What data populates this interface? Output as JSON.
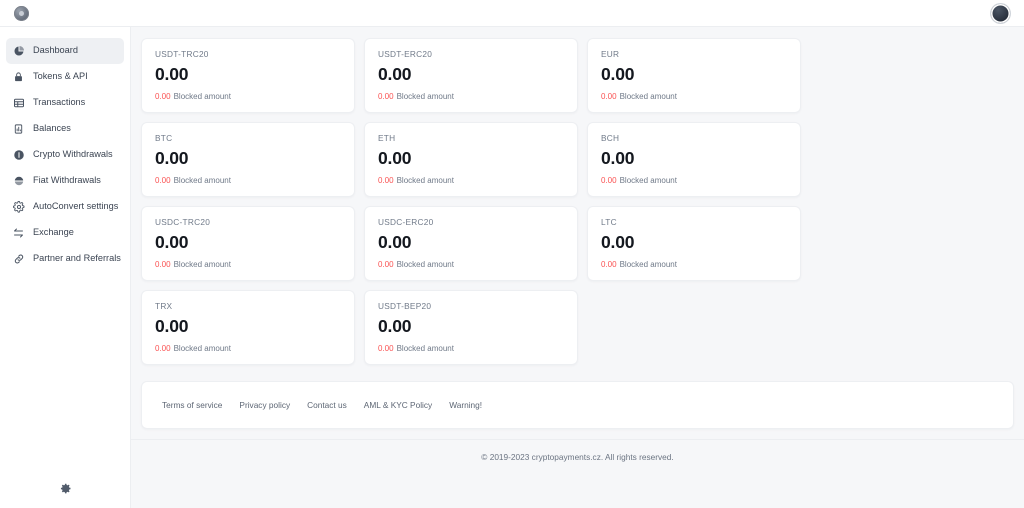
{
  "topbar": {
    "logo_icon": "circular-brand-logo",
    "avatar_icon": "user-avatar"
  },
  "sidebar": {
    "items": [
      {
        "label": "Dashboard",
        "icon": "pie-chart-icon",
        "active": true
      },
      {
        "label": "Tokens & API",
        "icon": "lock-icon",
        "active": false
      },
      {
        "label": "Transactions",
        "icon": "table-icon",
        "active": false
      },
      {
        "label": "Balances",
        "icon": "bar-chart-icon",
        "active": false
      },
      {
        "label": "Crypto Withdrawals",
        "icon": "coin-icon",
        "active": false
      },
      {
        "label": "Fiat Withdrawals",
        "icon": "banknote-icon",
        "active": false
      },
      {
        "label": "AutoConvert settings",
        "icon": "gear-icon",
        "active": false
      },
      {
        "label": "Exchange",
        "icon": "swap-arrows-icon",
        "active": false
      },
      {
        "label": "Partner and Referrals",
        "icon": "link-chain-icon",
        "active": false
      }
    ],
    "settings_icon": "gear-icon"
  },
  "main": {
    "balance_cards": [
      {
        "currency": "USDT-TRC20",
        "amount": "0.00",
        "blocked_amount": "0.00",
        "blocked_label": "Blocked amount"
      },
      {
        "currency": "USDT-ERC20",
        "amount": "0.00",
        "blocked_amount": "0.00",
        "blocked_label": "Blocked amount"
      },
      {
        "currency": "EUR",
        "amount": "0.00",
        "blocked_amount": "0.00",
        "blocked_label": "Blocked amount"
      },
      {
        "currency": "BTC",
        "amount": "0.00",
        "blocked_amount": "0.00",
        "blocked_label": "Blocked amount"
      },
      {
        "currency": "ETH",
        "amount": "0.00",
        "blocked_amount": "0.00",
        "blocked_label": "Blocked amount"
      },
      {
        "currency": "BCH",
        "amount": "0.00",
        "blocked_amount": "0.00",
        "blocked_label": "Blocked amount"
      },
      {
        "currency": "USDC-TRC20",
        "amount": "0.00",
        "blocked_amount": "0.00",
        "blocked_label": "Blocked amount"
      },
      {
        "currency": "USDC-ERC20",
        "amount": "0.00",
        "blocked_amount": "0.00",
        "blocked_label": "Blocked amount"
      },
      {
        "currency": "LTC",
        "amount": "0.00",
        "blocked_amount": "0.00",
        "blocked_label": "Blocked amount"
      },
      {
        "currency": "TRX",
        "amount": "0.00",
        "blocked_amount": "0.00",
        "blocked_label": "Blocked amount"
      },
      {
        "currency": "USDT-BEP20",
        "amount": "0.00",
        "blocked_amount": "0.00",
        "blocked_label": "Blocked amount"
      }
    ]
  },
  "footer": {
    "links": [
      {
        "label": "Terms of service"
      },
      {
        "label": "Privacy policy"
      },
      {
        "label": "Contact us"
      },
      {
        "label": "AML & KYC Policy"
      },
      {
        "label": "Warning!"
      }
    ],
    "copyright": "© 2019-2023 cryptopayments.cz. All rights reserved."
  },
  "colors": {
    "page_background": "#f6f7f9",
    "surface": "#ffffff",
    "border": "#edeff2",
    "text_primary": "#14181f",
    "text_muted": "#6f7988",
    "blocked_red": "#fa5252",
    "active_nav_background": "#eef0f3"
  }
}
